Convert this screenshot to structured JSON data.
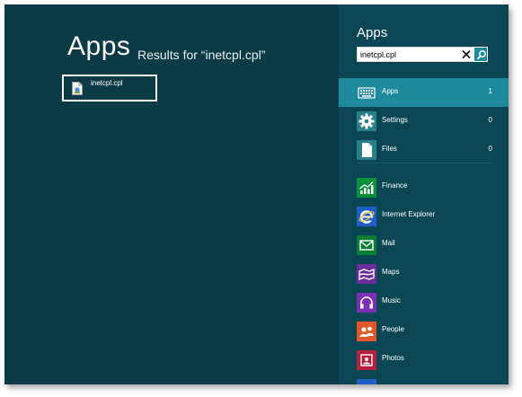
{
  "results": {
    "title": "Apps",
    "subtitle": "Results for “inetcpl.cpl”",
    "items": [
      {
        "label": "inetcpl.cpl",
        "icon": "control-panel-file-icon"
      }
    ]
  },
  "panel": {
    "title": "Apps",
    "search": {
      "value": "inetcpl.cpl",
      "placeholder": ""
    },
    "categories": [
      {
        "label": "Apps",
        "count": "1",
        "icon": "keyboard-icon",
        "selected": true
      },
      {
        "label": "Settings",
        "count": "0",
        "icon": "gear-icon",
        "selected": false
      },
      {
        "label": "Files",
        "count": "0",
        "icon": "document-icon",
        "selected": false
      }
    ],
    "apps": [
      {
        "label": "Finance",
        "icon": "finance-chart-icon",
        "color": "#0b8f3b"
      },
      {
        "label": "Internet Explorer",
        "icon": "internet-explorer-icon",
        "color": "#1d5ec9"
      },
      {
        "label": "Mail",
        "icon": "mail-envelope-icon",
        "color": "#0a7f33"
      },
      {
        "label": "Maps",
        "icon": "map-icon",
        "color": "#6b2d9c"
      },
      {
        "label": "Music",
        "icon": "headphones-icon",
        "color": "#7b2fb5"
      },
      {
        "label": "People",
        "icon": "people-icon",
        "color": "#e0572a"
      },
      {
        "label": "Photos",
        "icon": "photos-icon",
        "color": "#b51f3c"
      }
    ]
  },
  "colors": {
    "background": "#0d3a47",
    "panel": "#0b4655",
    "accent": "#1e8a9c"
  }
}
